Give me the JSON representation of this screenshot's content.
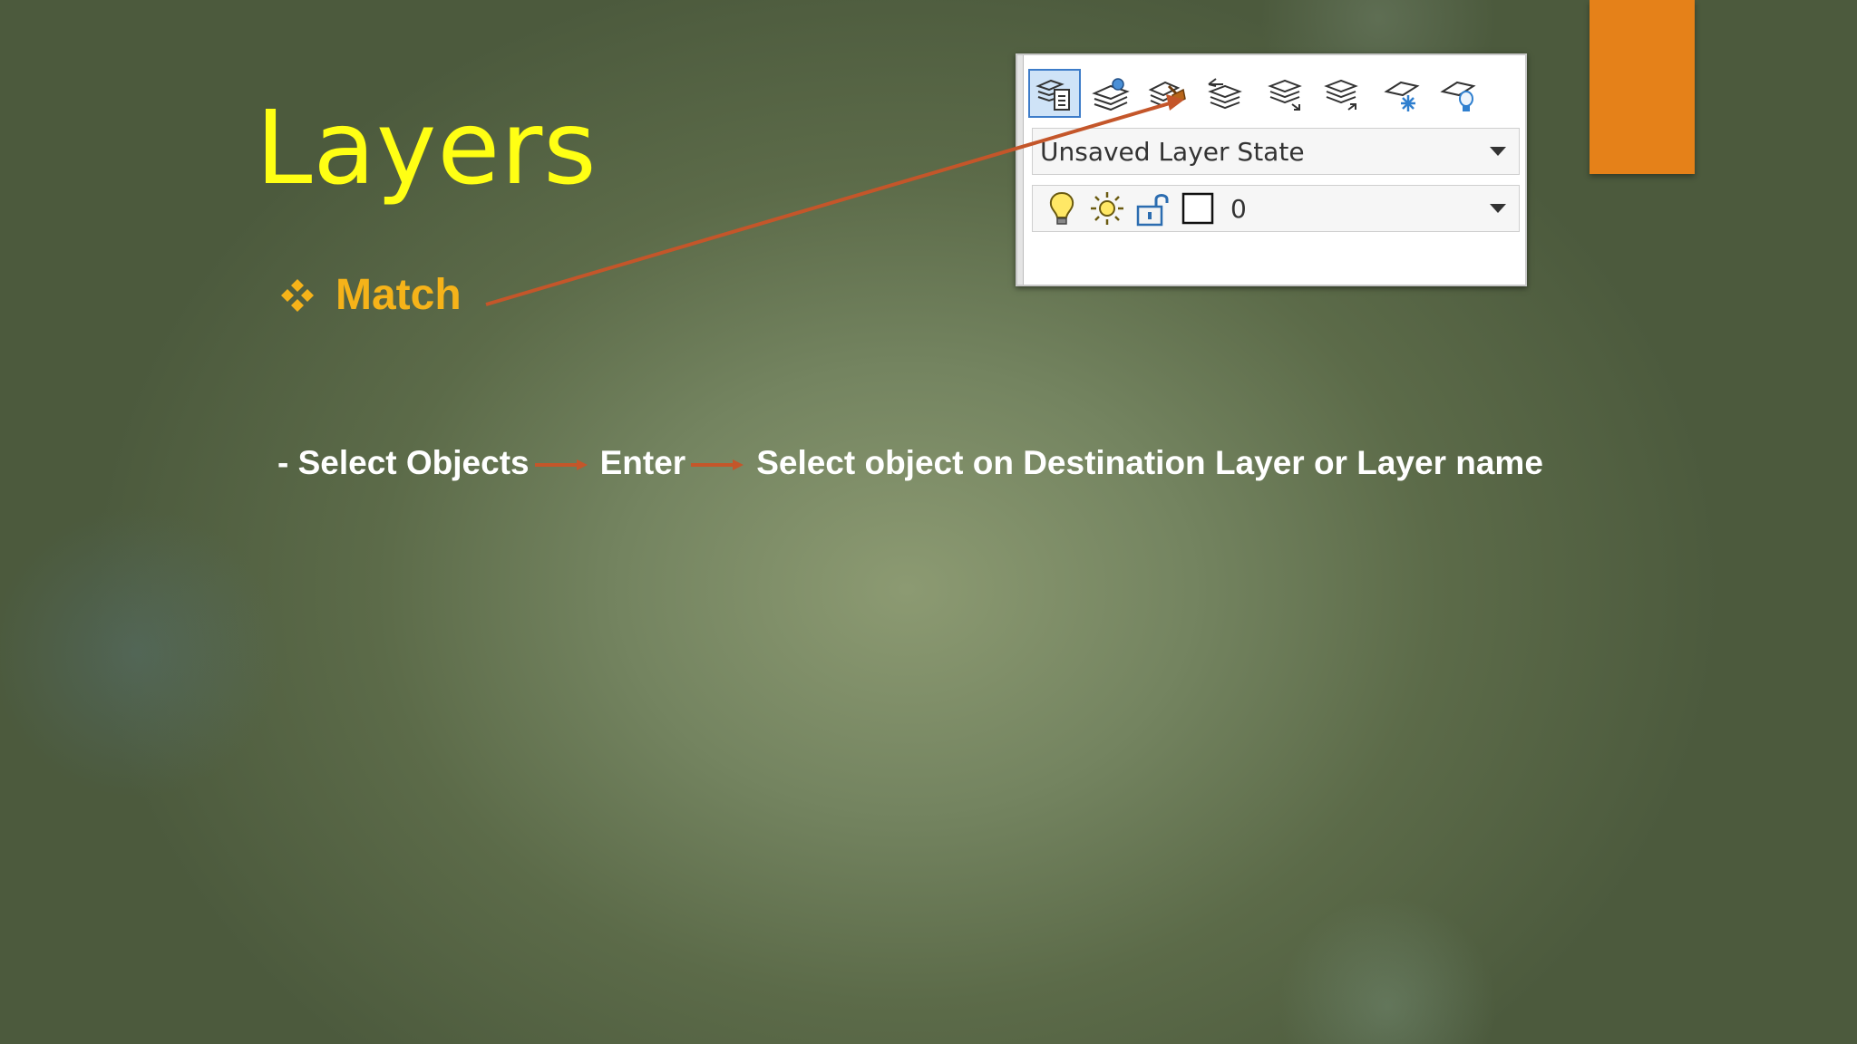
{
  "slide": {
    "title": "Layers",
    "bullet": {
      "icon": "four-diamond-bullet-icon",
      "label": "Match"
    },
    "steps": {
      "prefix": " - Select Objects",
      "step2": "Enter",
      "step3": "Select object on Destination Layer or Layer name",
      "arrow_icon": "right-arrow-icon"
    }
  },
  "layer_panel": {
    "toolbar_icons": [
      "layer-properties-icon",
      "make-current-layer-icon",
      "layer-match-icon",
      "previous-layer-icon",
      "layer-isolate-icon",
      "layer-unisolate-icon",
      "layer-freeze-icon",
      "layer-off-icon"
    ],
    "layer_state": "Unsaved Layer State",
    "current_layer": {
      "name": "0",
      "status_icons": [
        "lightbulb-on-icon",
        "sun-thaw-icon",
        "unlock-icon",
        "color-swatch-icon"
      ]
    }
  },
  "colors": {
    "title": "#ffff14",
    "bullet": "#f6b319",
    "accent_tab": "#e58119",
    "arrow": "#c4562a",
    "active_button_border": "#3d7cc9"
  }
}
